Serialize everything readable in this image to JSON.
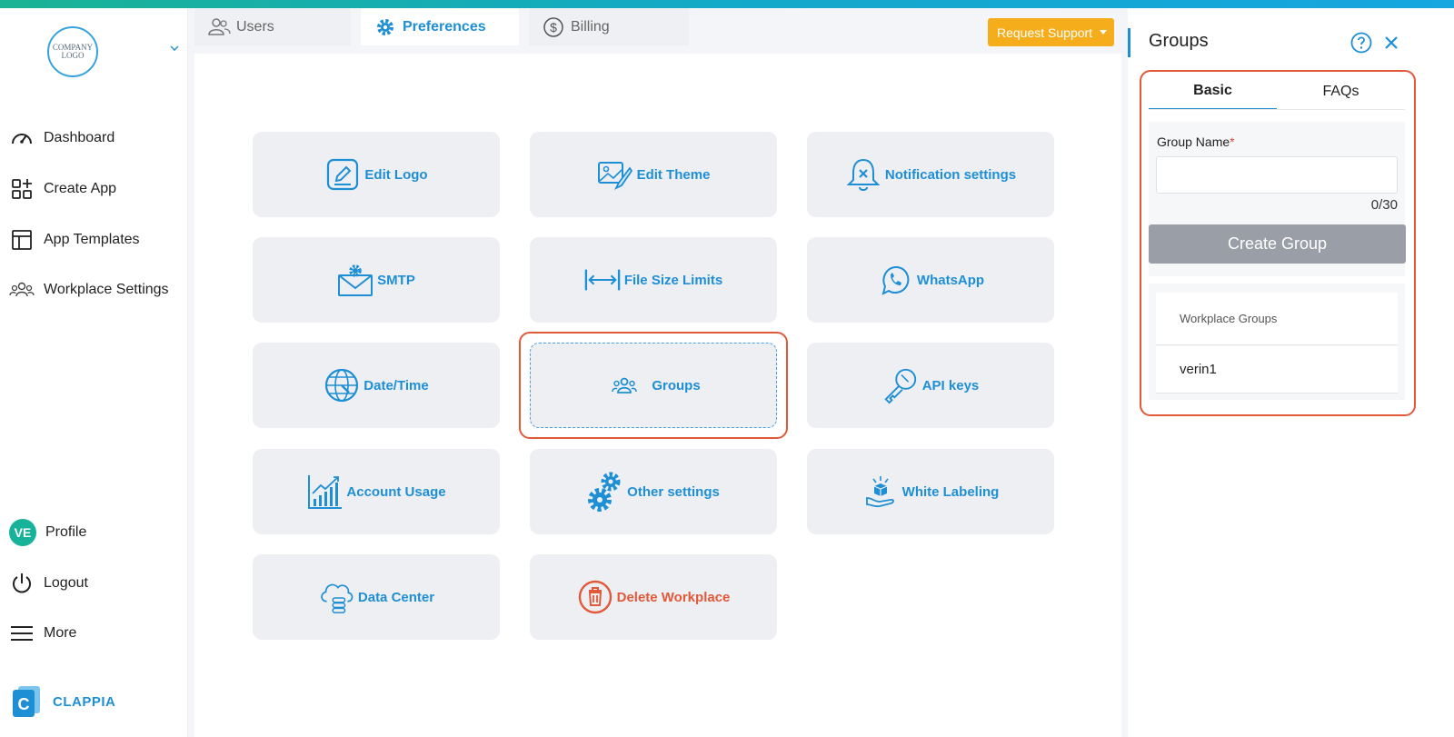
{
  "sidebar": {
    "logo_text": "COMPANY LOGO",
    "items": [
      {
        "label": "Dashboard",
        "icon": "gauge-icon"
      },
      {
        "label": "Create App",
        "icon": "grid-plus-icon"
      },
      {
        "label": "App Templates",
        "icon": "layout-icon"
      },
      {
        "label": "Workplace Settings",
        "icon": "people-icon"
      }
    ],
    "bottom": [
      {
        "label": "Profile",
        "avatar": "VE"
      },
      {
        "label": "Logout",
        "icon": "power-icon"
      },
      {
        "label": "More",
        "icon": "hamburger-icon"
      }
    ],
    "brand": "CLAPPIA"
  },
  "tabs": [
    {
      "label": "Users",
      "icon": "users-icon"
    },
    {
      "label": "Preferences",
      "icon": "gear-icon",
      "active": true
    },
    {
      "label": "Billing",
      "icon": "dollar-icon"
    }
  ],
  "request_support": "Request Support",
  "cards": [
    {
      "label": "Edit Logo",
      "icon": "edit-icon"
    },
    {
      "label": "Edit Theme",
      "icon": "image-brush-icon"
    },
    {
      "label": "Notification settings",
      "icon": "bell-icon"
    },
    {
      "label": "SMTP",
      "icon": "mail-gear-icon"
    },
    {
      "label": "File Size Limits",
      "icon": "arrows-horizontal-icon"
    },
    {
      "label": "WhatsApp",
      "icon": "whatsapp-icon"
    },
    {
      "label": "Date/Time",
      "icon": "globe-clock-icon"
    },
    {
      "label": "Groups",
      "icon": "group-icon",
      "selected": true
    },
    {
      "label": "API keys",
      "icon": "key-icon"
    },
    {
      "label": "Account Usage",
      "icon": "chart-up-icon"
    },
    {
      "label": "Other settings",
      "icon": "gears-icon"
    },
    {
      "label": "White Labeling",
      "icon": "white-label-icon"
    },
    {
      "label": "Data Center",
      "icon": "cloud-database-icon"
    },
    {
      "label": "Delete Workplace",
      "icon": "trash-icon"
    }
  ],
  "panel": {
    "title": "Groups",
    "tabs": [
      "Basic",
      "FAQs"
    ],
    "field_label": "Group Name",
    "required_mark": "*",
    "input_value": "",
    "counter": "0/30",
    "create_button": "Create Group",
    "groups_header": "Workplace Groups",
    "groups": [
      "verin1"
    ]
  },
  "colors": {
    "accent": "#1e8fd5",
    "danger": "#e2593a",
    "warning": "#f5ad1b",
    "avatar": "#16b29a"
  }
}
